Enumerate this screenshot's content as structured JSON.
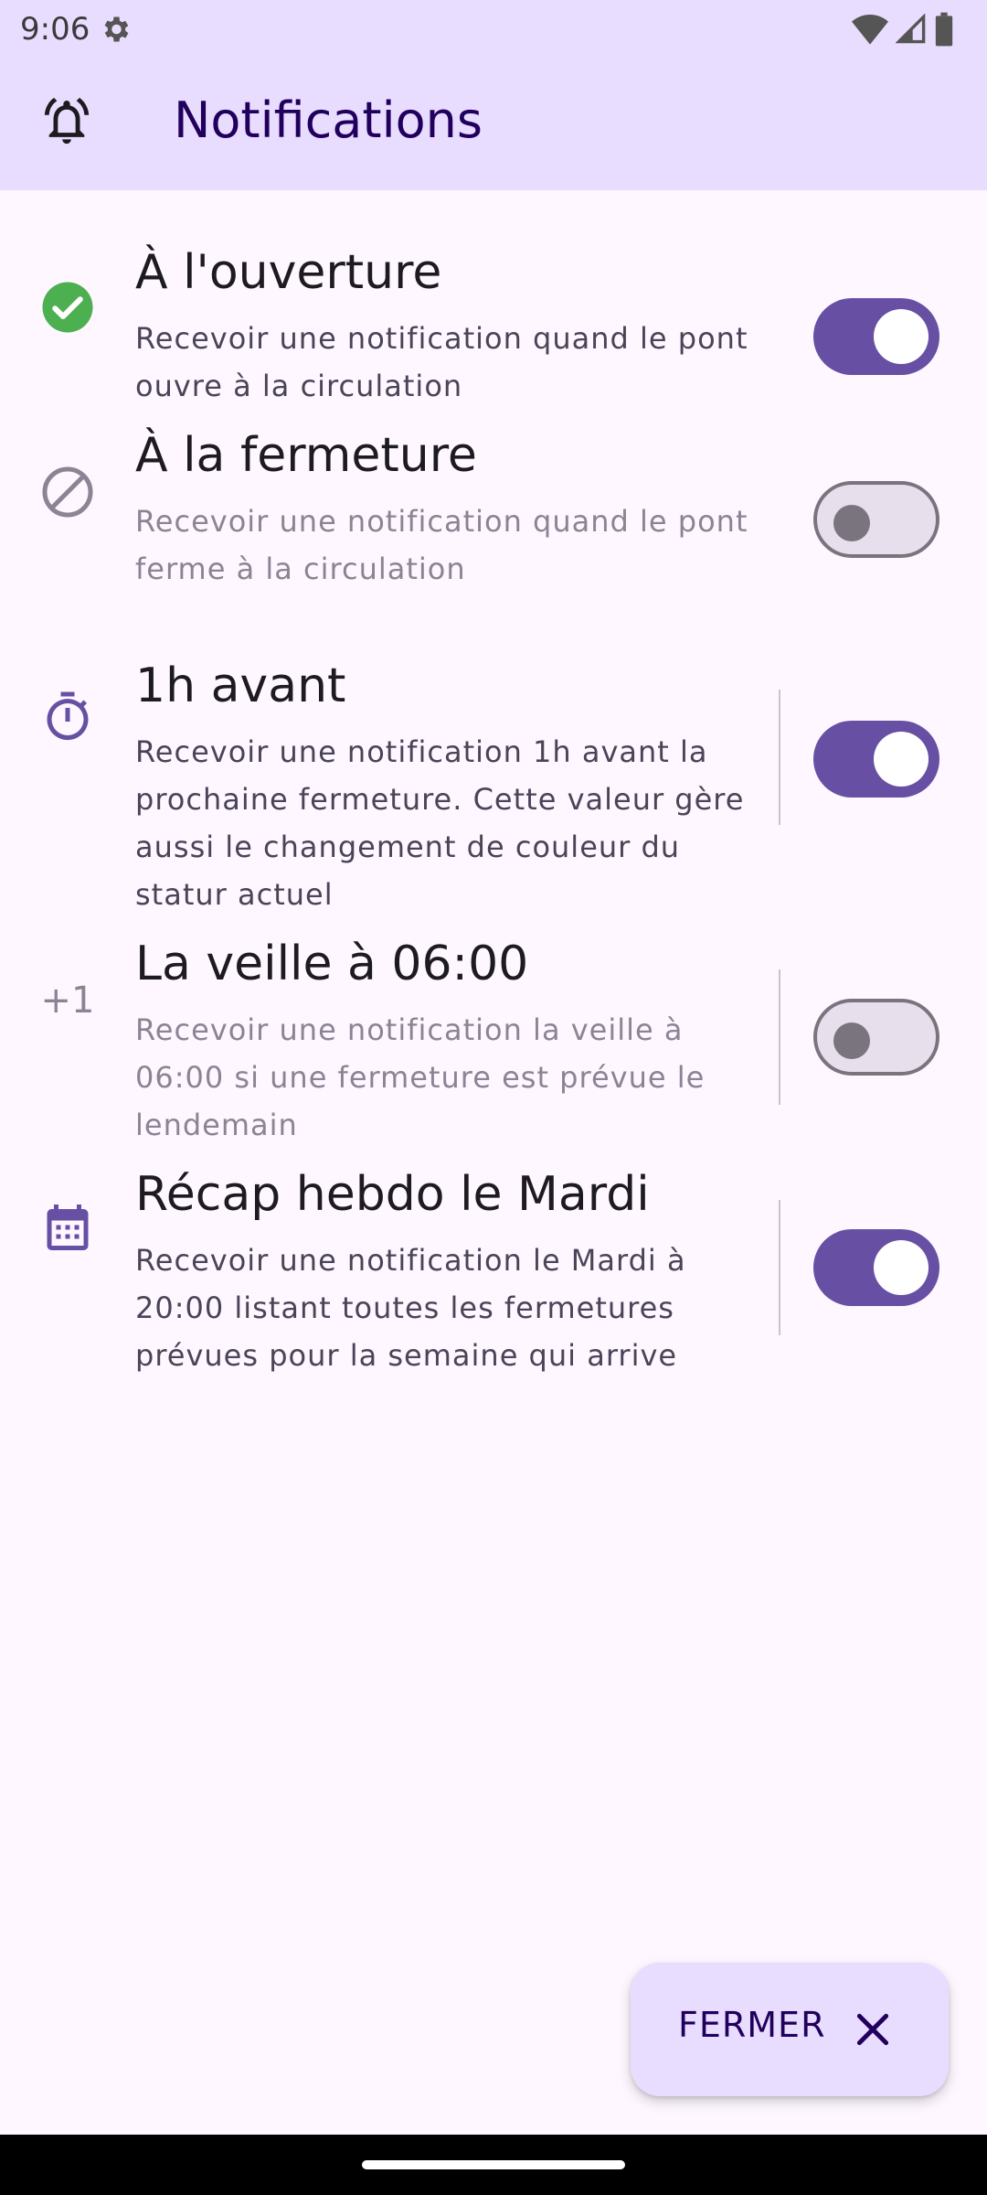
{
  "status_bar": {
    "time": "9:06"
  },
  "app_bar": {
    "title": "Notifications",
    "icon": "bell-alert-icon"
  },
  "settings": [
    {
      "title": "À l'ouverture",
      "description": "Recevoir une notification quand le pont ouvre à la circulation",
      "icon": "check-circle-icon",
      "enabled": true
    },
    {
      "title": "À la fermeture",
      "description": "Recevoir une notification quand le pont ferme à la circulation",
      "icon": "block-icon",
      "enabled": false
    },
    {
      "title": "1h avant",
      "description": "Recevoir une notification 1h avant la prochaine fermeture. Cette valeur gère aussi le changement de couleur du statur actuel",
      "icon": "timer-icon",
      "enabled": true
    },
    {
      "title": "La veille à 06:00",
      "description": "Recevoir une notification la veille à 06:00 si une fermeture est prévue le lendemain",
      "icon_text": "+1",
      "enabled": false
    },
    {
      "title": "Récap hebdo le Mardi",
      "description": "Recevoir une notification le Mardi à 20:00 listant toutes les fermetures prévues pour la semaine qui arrive",
      "icon": "calendar-icon",
      "enabled": true
    }
  ],
  "fab": {
    "label": "FERMER",
    "icon": "close-icon"
  },
  "colors": {
    "accent": "#6750a4",
    "header_bg": "#e9ddff",
    "success": "#4caf50"
  }
}
